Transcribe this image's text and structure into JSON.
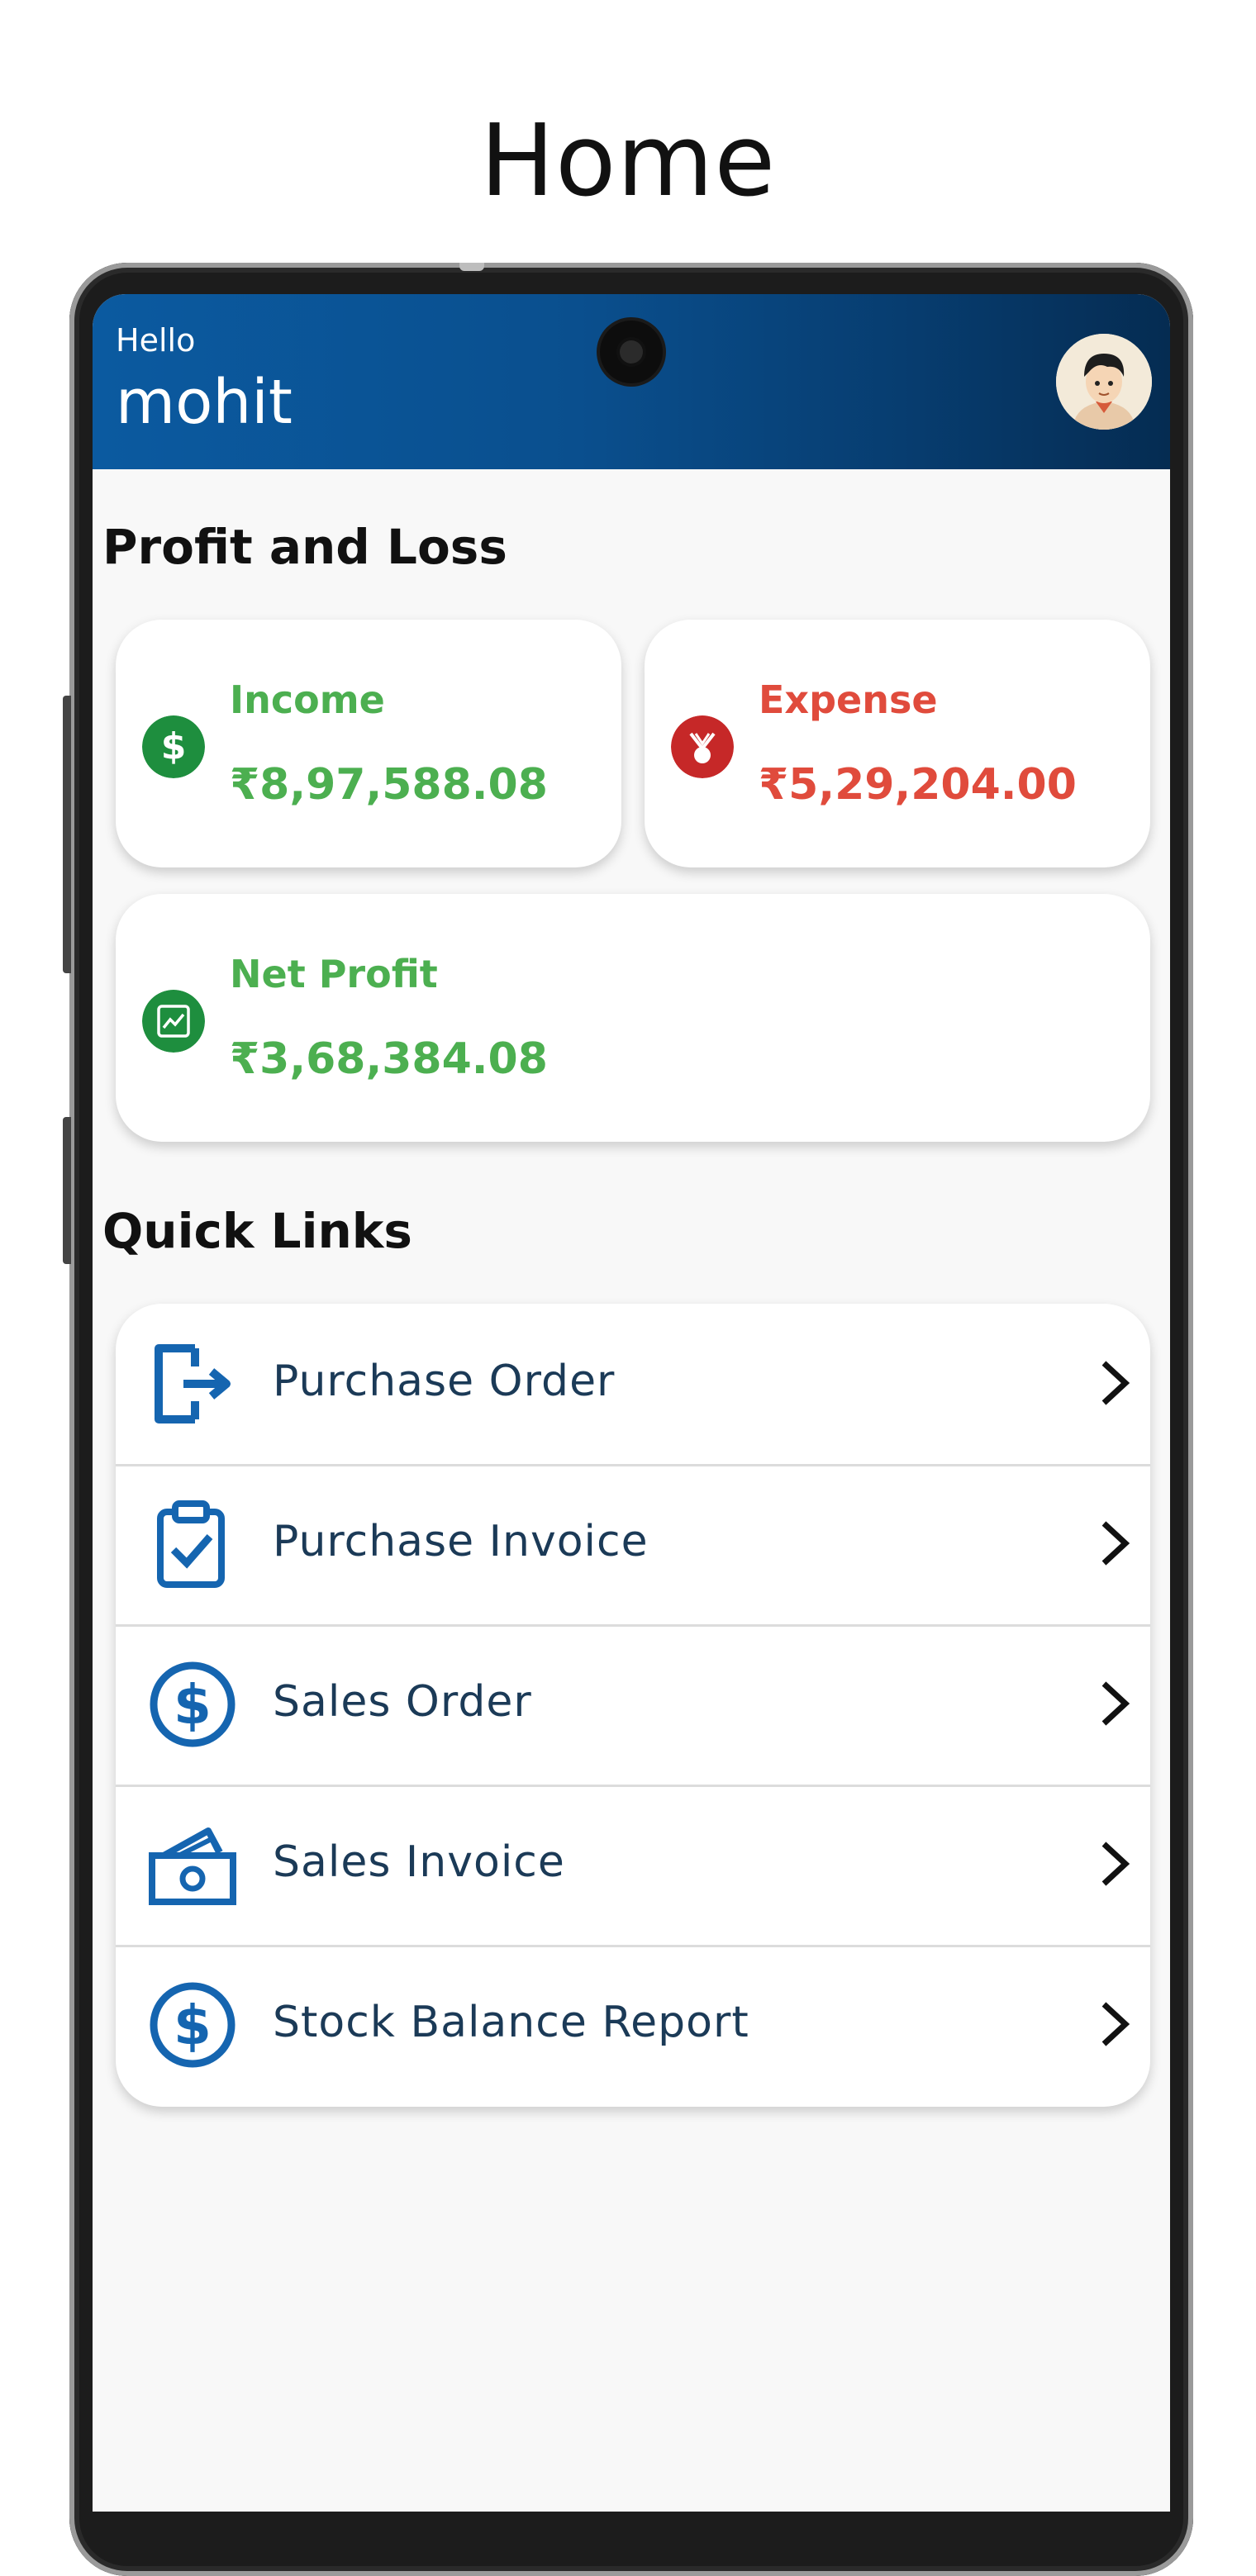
{
  "page": {
    "title": "Home"
  },
  "header": {
    "greeting": "Hello",
    "username": "mohit"
  },
  "profit_loss": {
    "title": "Profit and Loss",
    "income": {
      "label": "Income",
      "value": "₹8,97,588.08",
      "color": "#4caf50"
    },
    "expense": {
      "label": "Expense",
      "value": "₹5,29,204.00",
      "color": "#e04b3c"
    },
    "net_profit": {
      "label": "Net Profit",
      "value": "₹3,68,384.08",
      "color": "#4caf50"
    }
  },
  "quick_links": {
    "title": "Quick Links",
    "items": [
      {
        "label": "Purchase Order",
        "icon": "exit-box-icon"
      },
      {
        "label": "Purchase Invoice",
        "icon": "clipboard-check-icon"
      },
      {
        "label": "Sales Order",
        "icon": "dollar-circle-icon"
      },
      {
        "label": "Sales Invoice",
        "icon": "money-stack-icon"
      },
      {
        "label": "Stock Balance Report",
        "icon": "dollar-circle-icon"
      }
    ]
  },
  "colors": {
    "header_start": "#0b5aa0",
    "header_end": "#052c52",
    "link_icon": "#1565b0"
  }
}
